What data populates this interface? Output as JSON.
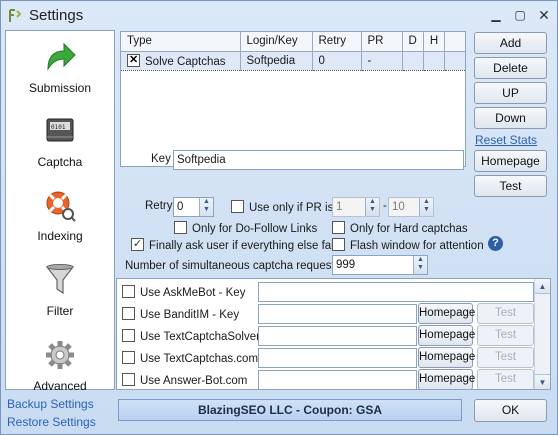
{
  "window": {
    "title": "Settings"
  },
  "sidebar": {
    "items": [
      {
        "label": "Submission",
        "icon": "green-arrow-icon"
      },
      {
        "label": "Captcha",
        "icon": "captcha-icon"
      },
      {
        "label": "Indexing",
        "icon": "lifebuoy-icon"
      },
      {
        "label": "Filter",
        "icon": "funnel-icon"
      },
      {
        "label": "Advanced",
        "icon": "gear-icon"
      }
    ]
  },
  "footer_links": {
    "backup": "Backup Settings",
    "restore": "Restore Settings"
  },
  "grid": {
    "columns": [
      "Type",
      "Login/Key",
      "Retry",
      "PR",
      "D",
      "H"
    ],
    "rows": [
      {
        "checked": true,
        "type": "Solve Captchas",
        "login": "Softpedia",
        "retry": "0",
        "pr": "-",
        "d": "",
        "h": ""
      }
    ]
  },
  "right_buttons": {
    "add": "Add",
    "delete": "Delete",
    "up": "UP",
    "down": "Down",
    "reset": "Reset Stats",
    "homepage": "Homepage",
    "test": "Test"
  },
  "key": {
    "label": "Key",
    "value": "Softpedia"
  },
  "options": {
    "retry_label": "Retry",
    "retry_value": "0",
    "use_only_pr": "Use only if PR is",
    "pr_from": "1",
    "pr_dash": "-",
    "pr_to": "10",
    "only_dofollow": "Only for Do-Follow Links",
    "only_hard": "Only for Hard captchas",
    "finally_ask": "Finally ask user if everything else fails",
    "flash_window": "Flash window for attention",
    "simultaneous_label": "Number of simultaneous captcha requests",
    "simultaneous_value": "999"
  },
  "services": [
    {
      "name": "Use AskMeBot - Key",
      "homepage": "",
      "test": ""
    },
    {
      "name": "Use BanditIM - Key",
      "homepage": "Homepage",
      "test": "Test"
    },
    {
      "name": "Use TextCaptchaSolver",
      "homepage": "Homepage",
      "test": "Test"
    },
    {
      "name": "Use TextCaptchas.com",
      "homepage": "Homepage",
      "test": "Test"
    },
    {
      "name": "Use Answer-Bot.com",
      "homepage": "Homepage",
      "test": "Test"
    }
  ],
  "status": {
    "text": "BlazingSEO LLC - Coupon: GSA"
  },
  "ok_button": "OK"
}
